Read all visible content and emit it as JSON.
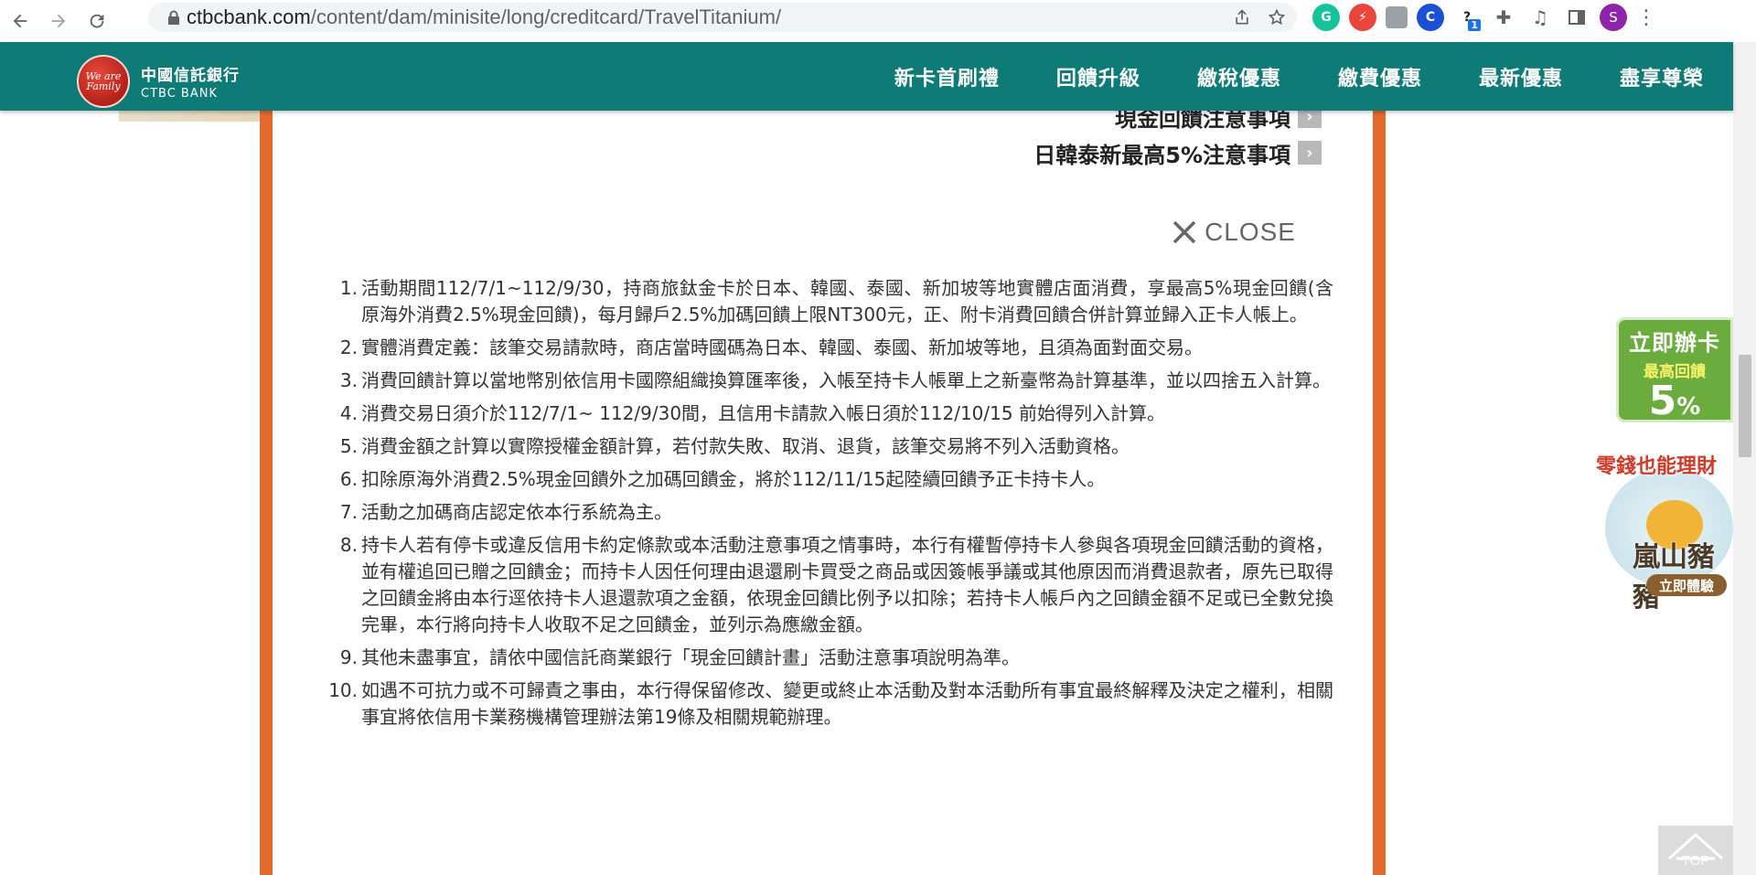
{
  "browser": {
    "url_domain": "ctbcbank.com",
    "url_path": "/content/dam/minisite/long/creditcard/TravelTitanium/",
    "badge_count": "1",
    "profile_initial": "S",
    "unknown_ext_label": "?"
  },
  "header": {
    "logo_zh": "中國信託銀行",
    "logo_en": "CTBC BANK",
    "logo_mark": "We are Family",
    "nav": [
      "新卡首刷禮",
      "回饋升級",
      "繳稅優惠",
      "繳費優惠",
      "最新優惠",
      "盡享尊榮"
    ]
  },
  "modal": {
    "link_cash_notice": "現金回饋注意事項",
    "link_jk_notice": "日韓泰新最高5%注意事項",
    "close_label": "CLOSE",
    "terms": [
      {
        "num": "1.",
        "text": "活動期間112/7/1~112/9/30，持商旅鈦金卡於日本、韓國、泰國、新加坡等地實體店面消費，享最高5%現金回饋(含原海外消費2.5%現金回饋)，每月歸戶2.5%加碼回饋上限NT300元，正、附卡消費回饋合併計算並歸入正卡人帳上。"
      },
      {
        "num": "2.",
        "text": "實體消費定義：該筆交易請款時，商店當時國碼為日本、韓國、泰國、新加坡等地，且須為面對面交易。"
      },
      {
        "num": "3.",
        "text": "消費回饋計算以當地幣別依信用卡國際組織換算匯率後，入帳至持卡人帳單上之新臺幣為計算基準，並以四捨五入計算。"
      },
      {
        "num": "4.",
        "text": "消費交易日須介於112/7/1~ 112/9/30間，且信用卡請款入帳日須於112/10/15 前始得列入計算。"
      },
      {
        "num": "5.",
        "text": "消費金額之計算以實際授權金額計算，若付款失敗、取消、退貨，該筆交易將不列入活動資格。"
      },
      {
        "num": "6.",
        "text": "扣除原海外消費2.5%現金回饋外之加碼回饋金，將於112/11/15起陸續回饋予正卡持卡人。"
      },
      {
        "num": "7.",
        "text": "活動之加碼商店認定依本行系統為主。"
      },
      {
        "num": "8.",
        "text": "持卡人若有停卡或違反信用卡約定條款或本活動注意事項之情事時，本行有權暫停持卡人參與各項現金回饋活動的資格，並有權追回已贈之回饋金；而持卡人因任何理由退還刷卡買受之商品或因簽帳爭議或其他原因而消費退款者，原先已取得之回饋金將由本行逕依持卡人退還款項之金額，依現金回饋比例予以扣除；若持卡人帳戶內之回饋金額不足或已全數兌換完畢，本行將向持卡人收取不足之回饋金，並列示為應繳金額。"
      },
      {
        "num": "9.",
        "text": "其他未盡事宜，請依中國信託商業銀行「現金回饋計畫」活動注意事項說明為準。"
      },
      {
        "num": "10.",
        "text": "如遇不可抗力或不可歸責之事由，本行得保留修改、變更或終止本活動及對本活動所有事宜最終解釋及決定之權利，相關事宜將依信用卡業務機構管理辦法第19條及相關規範辦理。"
      }
    ]
  },
  "side": {
    "apply_title": "立即辦卡",
    "apply_sub": "最高回饋",
    "apply_pct": "5",
    "apply_pct_sign": "%",
    "pig_top": "零錢也能理財",
    "pig_name": "嵐山豬豬",
    "pig_cta": "立即體驗",
    "top_label": "TOP"
  },
  "colors": {
    "header_bg": "#0e7b77",
    "modal_border": "#e26a2c",
    "apply_bg": "#6aac3d"
  }
}
